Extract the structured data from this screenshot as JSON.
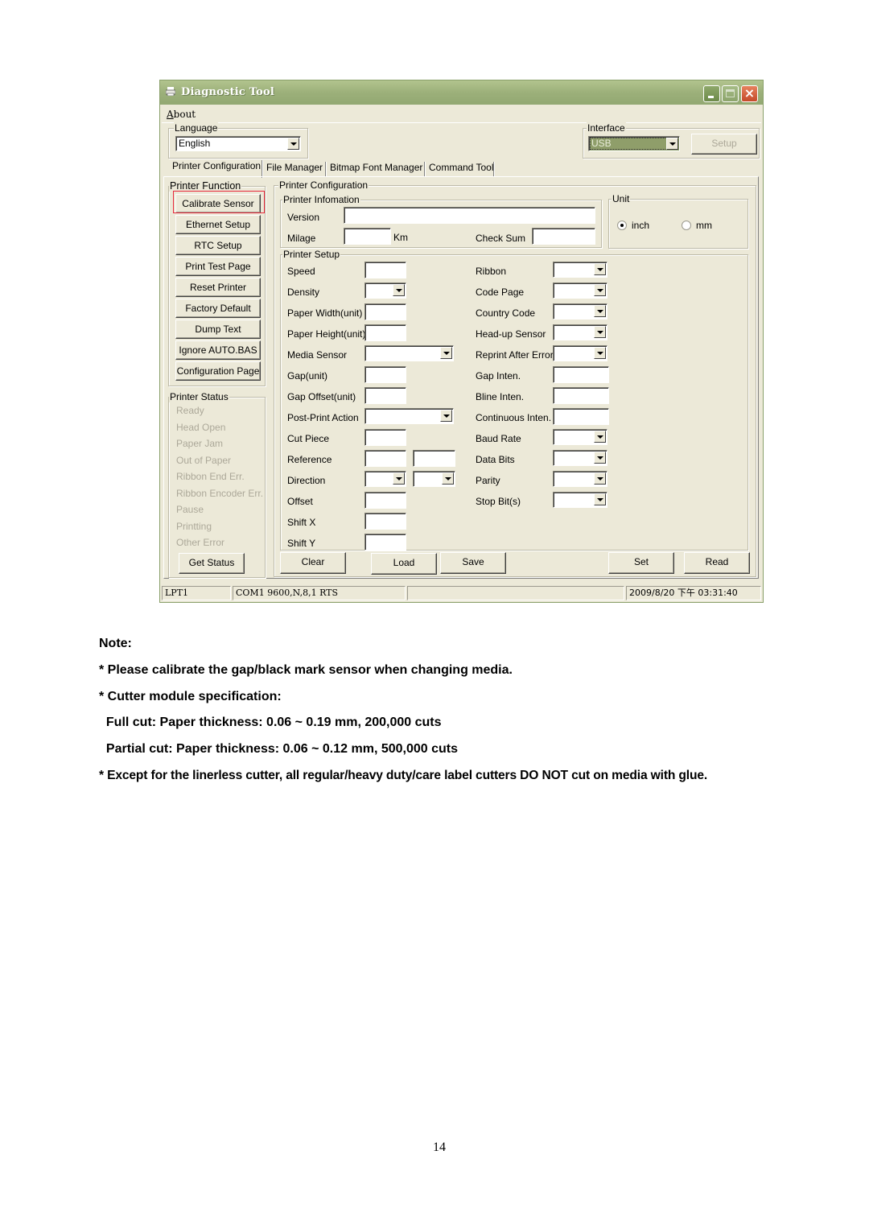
{
  "window": {
    "title": "Diagnostic Tool",
    "menu": {
      "about_prefix": "A",
      "about_rest": "bout"
    },
    "controls": {
      "minimize": "minimize",
      "maximize": "maximize",
      "close": "×"
    }
  },
  "language": {
    "legend": "Language",
    "value": "English"
  },
  "interface": {
    "legend": "Interface",
    "value": "USB",
    "setup_label": "Setup",
    "setup_enabled": false
  },
  "tabs": [
    {
      "label": "Printer Configuration",
      "active": true
    },
    {
      "label": "File Manager",
      "active": false
    },
    {
      "label": "Bitmap Font Manager",
      "active": false
    },
    {
      "label": "Command Tool",
      "active": false
    }
  ],
  "printer_function": {
    "legend": "Printer Function",
    "buttons": [
      {
        "label": "Calibrate Sensor",
        "highlighted": true
      },
      {
        "label": "Ethernet Setup"
      },
      {
        "label": "RTC Setup"
      },
      {
        "label": "Print Test Page"
      },
      {
        "label": "Reset Printer"
      },
      {
        "label": "Factory Default"
      },
      {
        "label": "Dump Text"
      },
      {
        "label": "Ignore AUTO.BAS"
      },
      {
        "label": "Configuration Page"
      }
    ]
  },
  "printer_status": {
    "legend": "Printer Status",
    "items": [
      "Ready",
      "Head Open",
      "Paper Jam",
      "Out of Paper",
      "Ribbon End Err.",
      "Ribbon Encoder Err.",
      "Pause",
      "Printting",
      "Other Error"
    ],
    "get_status_label": "Get Status"
  },
  "printer_configuration": {
    "legend": "Printer Configuration",
    "info": {
      "legend": "Printer Infomation",
      "version_label": "Version",
      "version_value": "",
      "milage_label": "Milage",
      "milage_value": "",
      "milage_unit": "Km",
      "checksum_label": "Check Sum",
      "checksum_value": ""
    },
    "unit": {
      "legend": "Unit",
      "options": [
        "inch",
        "mm"
      ],
      "selected": "inch"
    },
    "setup": {
      "legend": "Printer Setup",
      "left_fields": [
        {
          "label": "Speed",
          "type": "input",
          "value": ""
        },
        {
          "label": "Density",
          "type": "combo",
          "value": ""
        },
        {
          "label": "Paper Width(unit)",
          "type": "input",
          "value": ""
        },
        {
          "label": "Paper Height(unit)",
          "type": "input",
          "value": ""
        },
        {
          "label": "Media Sensor",
          "type": "combo-wide",
          "value": ""
        },
        {
          "label": "Gap(unit)",
          "type": "input",
          "value": ""
        },
        {
          "label": "Gap Offset(unit)",
          "type": "input",
          "value": ""
        },
        {
          "label": "Post-Print Action",
          "type": "combo-wide",
          "value": ""
        },
        {
          "label": "Cut Piece",
          "type": "input",
          "value": ""
        },
        {
          "label": "Reference",
          "type": "input-pair",
          "value": ""
        },
        {
          "label": "Direction",
          "type": "combo-pair",
          "value": ""
        },
        {
          "label": "Offset",
          "type": "input",
          "value": ""
        },
        {
          "label": "Shift X",
          "type": "input",
          "value": ""
        },
        {
          "label": "Shift Y",
          "type": "input",
          "value": ""
        }
      ],
      "right_fields": [
        {
          "label": "Ribbon",
          "type": "combo",
          "value": ""
        },
        {
          "label": "Code Page",
          "type": "combo",
          "value": ""
        },
        {
          "label": "Country Code",
          "type": "combo",
          "value": ""
        },
        {
          "label": "Head-up Sensor",
          "type": "combo",
          "value": ""
        },
        {
          "label": "Reprint After Error",
          "type": "combo",
          "value": ""
        },
        {
          "label": "Gap Inten.",
          "type": "input",
          "value": ""
        },
        {
          "label": "Bline Inten.",
          "type": "input",
          "value": ""
        },
        {
          "label": "Continuous Inten.",
          "type": "input",
          "value": ""
        },
        {
          "label": "Baud Rate",
          "type": "combo",
          "value": ""
        },
        {
          "label": "Data Bits",
          "type": "combo",
          "value": ""
        },
        {
          "label": "Parity",
          "type": "combo",
          "value": ""
        },
        {
          "label": "Stop Bit(s)",
          "type": "combo",
          "value": ""
        }
      ]
    },
    "actions": {
      "clear": "Clear",
      "load": "Load",
      "save": "Save",
      "set": "Set",
      "read": "Read"
    }
  },
  "statusbar": {
    "port": "LPT1",
    "com": "COM1 9600,N,8,1 RTS",
    "message": "",
    "datetime": "2009/8/20 下午 03:31:40"
  },
  "notes": {
    "heading": "Note:",
    "lines": [
      "* Please calibrate the gap/black mark sensor when changing media.",
      "* Cutter module specification:",
      "  Full cut: Paper thickness: 0.06 ~ 0.19 mm, 200,000 cuts",
      "  Partial cut: Paper thickness: 0.06 ~ 0.12 mm, 500,000 cuts",
      "* Except for the linerless cutter, all regular/heavy duty/care label cutters DO NOT cut on media with glue."
    ]
  },
  "page_number": "14"
}
